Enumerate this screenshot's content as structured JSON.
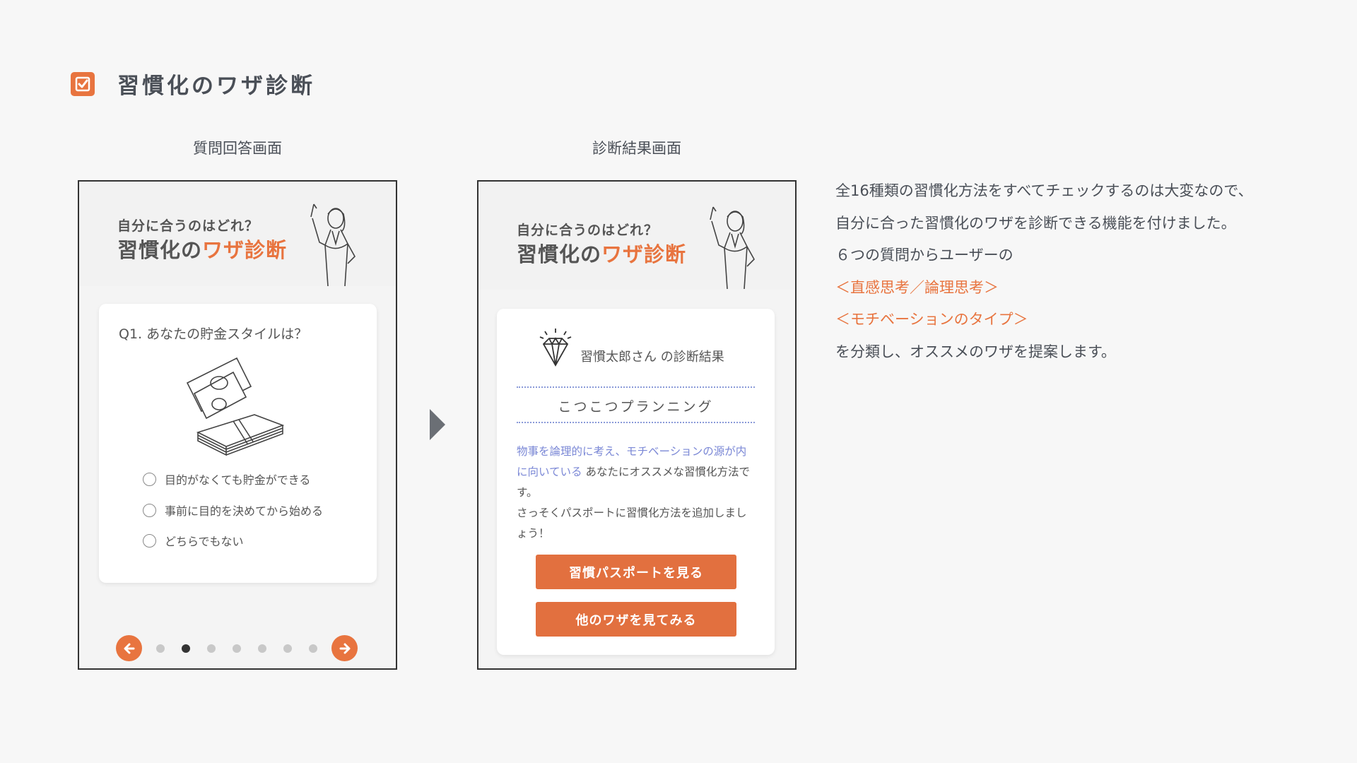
{
  "header": {
    "title": "習慣化のワザ診断",
    "icon": "check-square-icon",
    "accent": "#e8743f"
  },
  "left_screen": {
    "label": "質問回答画面",
    "banner": {
      "sub": "自分に合うのはどれ？",
      "main_a": "習慣化の",
      "main_b": "ワザ診断"
    },
    "question": "Q1. あなたの貯金スタイルは？",
    "options": [
      "目的がなくても貯金ができる",
      "事前に目的を決めてから始める",
      "どちらでもない"
    ],
    "pager": {
      "prev_icon": "arrow-left-icon",
      "next_icon": "arrow-right-icon",
      "dot_count": 7,
      "active_dot": 2
    }
  },
  "right_screen": {
    "label": "診断結果画面",
    "banner": {
      "sub": "自分に合うのはどれ？",
      "main_a": "習慣化の",
      "main_b": "ワザ診断"
    },
    "result_title": "習慣太郎さん の診断結果",
    "type_name": "こつこつプランニング",
    "desc_highlight": "物事を論理的に考え、モチベーションの源が内に向いている",
    "desc_rest": "あなたにオススメな習慣化方法です。",
    "desc_line2": "さっそくパスポートに習慣化方法を追加しましょう！",
    "button1": "習慣パスポートを見る",
    "button2": "他のワザを見てみる"
  },
  "side": {
    "line1": "全16種類の習慣化方法をすべてチェックするのは大変なので、",
    "line2": "自分に合った習慣化のワザを診断できる機能を付けました。",
    "line3": "６つの質問からユーザーの",
    "line4": "＜直感思考／論理思考＞",
    "line5": "＜モチベーションのタイプ＞",
    "line6": "を分類し、オススメのワザを提案します。"
  }
}
